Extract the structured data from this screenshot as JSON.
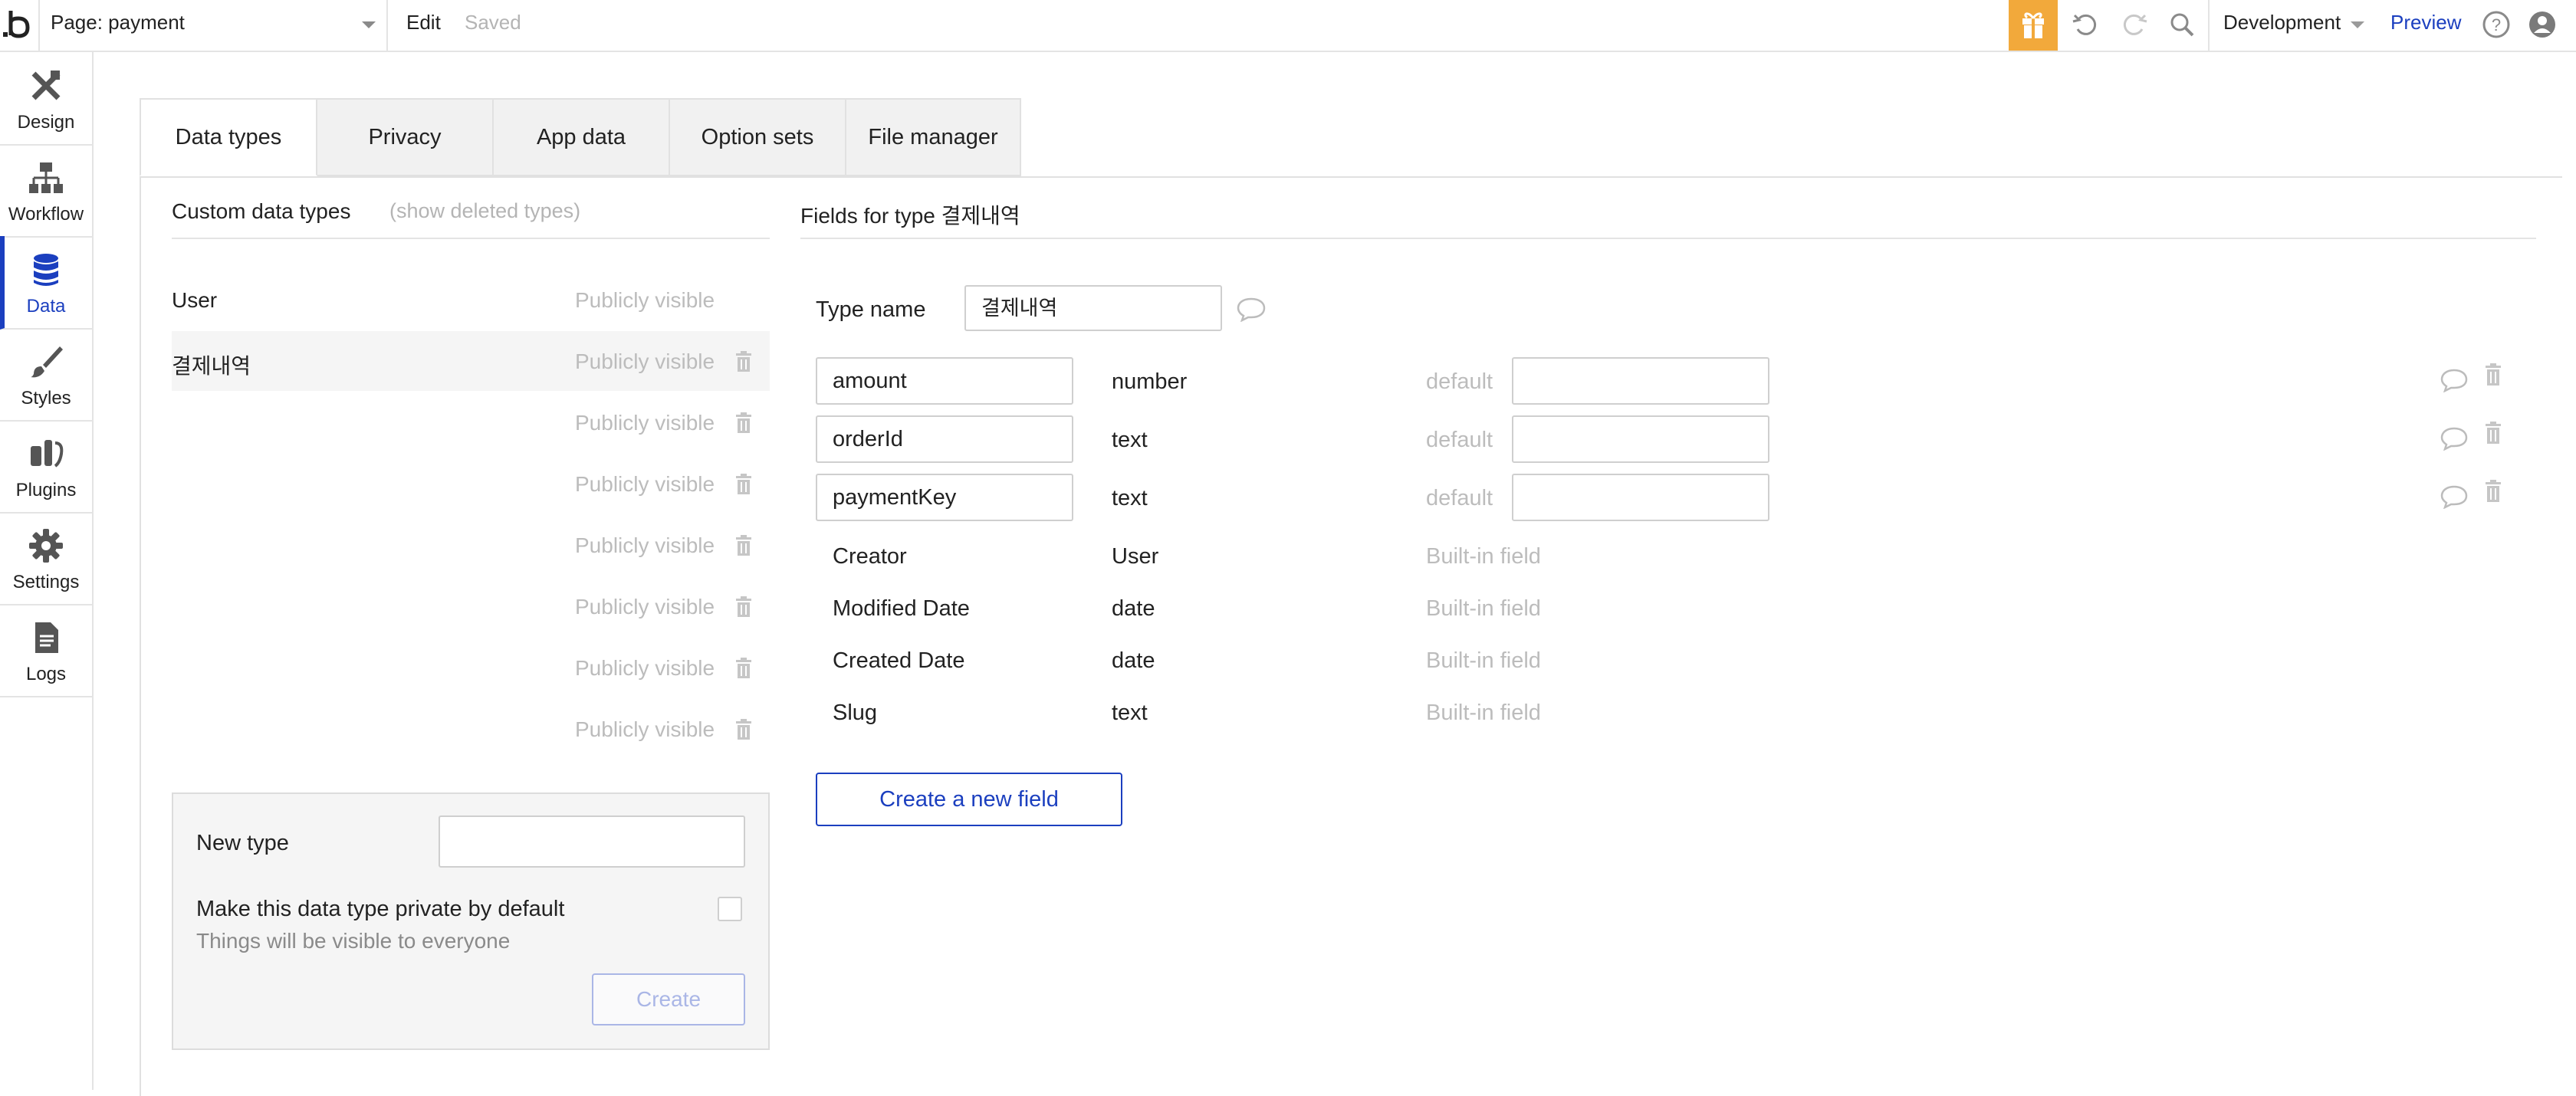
{
  "topbar": {
    "page_label": "Page: payment",
    "edit_label": "Edit",
    "saved_label": "Saved",
    "environment": "Development",
    "preview_label": "Preview",
    "accent_color": "#f2a93b",
    "link_color": "#1b3fbf"
  },
  "sidebar": {
    "items": [
      {
        "label": "Design",
        "icon": "design-icon"
      },
      {
        "label": "Workflow",
        "icon": "workflow-icon"
      },
      {
        "label": "Data",
        "icon": "database-icon",
        "active": true
      },
      {
        "label": "Styles",
        "icon": "brush-icon"
      },
      {
        "label": "Plugins",
        "icon": "plug-icon"
      },
      {
        "label": "Settings",
        "icon": "gear-icon"
      },
      {
        "label": "Logs",
        "icon": "document-icon"
      }
    ]
  },
  "tabs": [
    {
      "label": "Data types",
      "active": true
    },
    {
      "label": "Privacy"
    },
    {
      "label": "App data"
    },
    {
      "label": "Option sets"
    },
    {
      "label": "File manager"
    }
  ],
  "custom_types": {
    "title": "Custom data types",
    "show_deleted": "(show deleted types)",
    "rows": [
      {
        "name": "User",
        "visibility": "Publicly visible",
        "selected": false
      },
      {
        "name": "결제내역",
        "visibility": "Publicly visible",
        "selected": true
      },
      {
        "name": "",
        "visibility": "Publicly visible"
      },
      {
        "name": "",
        "visibility": "Publicly visible"
      },
      {
        "name": "",
        "visibility": "Publicly visible"
      },
      {
        "name": "",
        "visibility": "Publicly visible"
      },
      {
        "name": "",
        "visibility": "Publicly visible"
      },
      {
        "name": "",
        "visibility": "Publicly visible"
      }
    ]
  },
  "new_type": {
    "label": "New type",
    "value": "",
    "private_label": "Make this data type private by default",
    "private_checked": false,
    "private_help": "Things will be visible to everyone",
    "create_label": "Create"
  },
  "fields_panel": {
    "title": "Fields for type 결제내역",
    "type_name_label": "Type name",
    "type_name_value": "결제내역",
    "fields": [
      {
        "name": "amount",
        "type": "number",
        "default_label": "default",
        "default_value": ""
      },
      {
        "name": "orderId",
        "type": "text",
        "default_label": "default",
        "default_value": ""
      },
      {
        "name": "paymentKey",
        "type": "text",
        "default_label": "default",
        "default_value": ""
      }
    ],
    "builtin": [
      {
        "name": "Creator",
        "type": "User",
        "flag": "Built-in field"
      },
      {
        "name": "Modified Date",
        "type": "date",
        "flag": "Built-in field"
      },
      {
        "name": "Created Date",
        "type": "date",
        "flag": "Built-in field"
      },
      {
        "name": "Slug",
        "type": "text",
        "flag": "Built-in field"
      }
    ],
    "create_field_label": "Create a new field"
  }
}
